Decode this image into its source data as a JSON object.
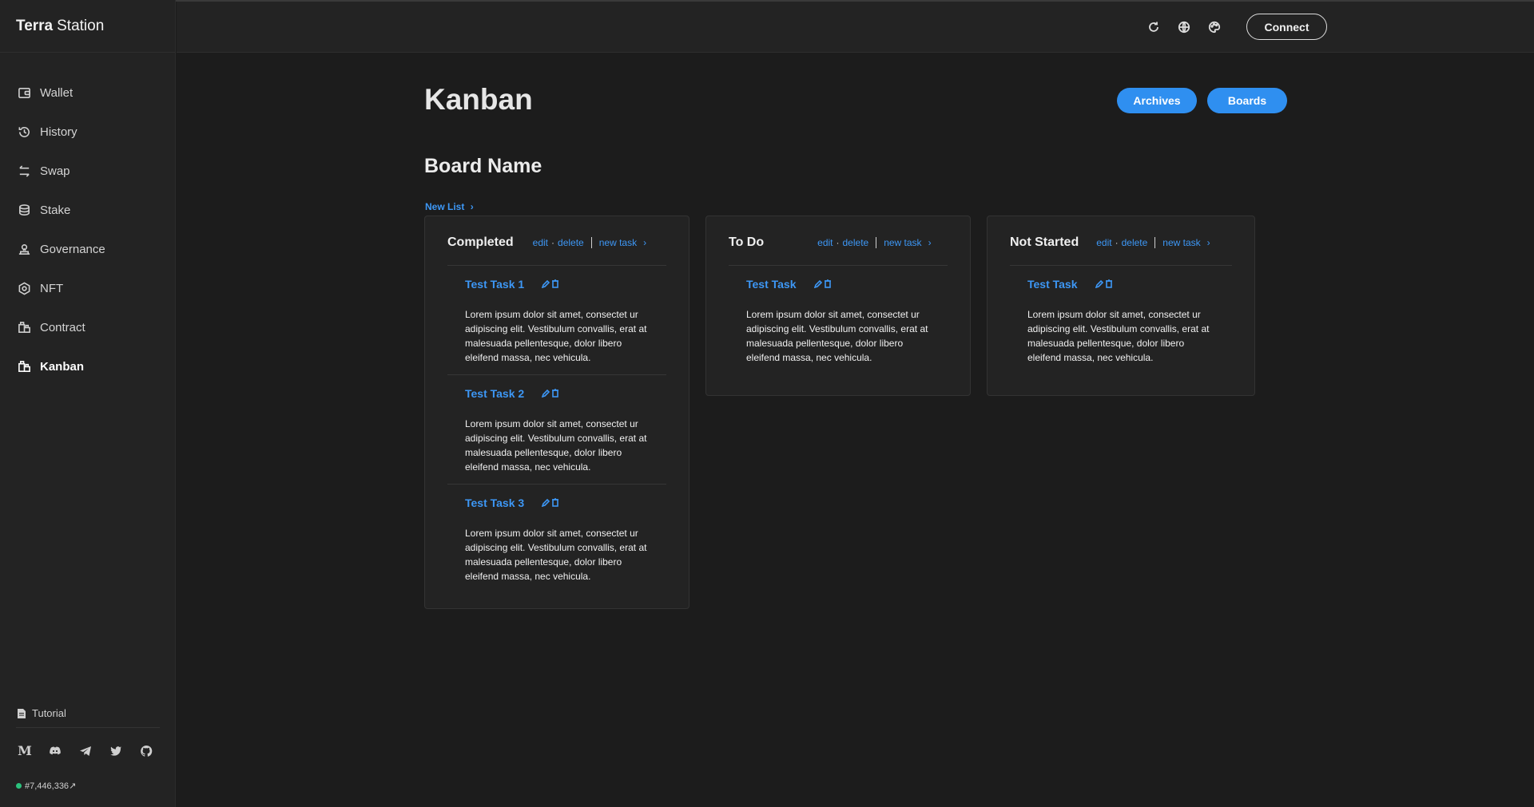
{
  "brand": {
    "bold": "Terra",
    "regular": "Station"
  },
  "nav": [
    {
      "label": "Wallet",
      "icon": "wallet-icon"
    },
    {
      "label": "History",
      "icon": "history-icon"
    },
    {
      "label": "Swap",
      "icon": "swap-icon"
    },
    {
      "label": "Stake",
      "icon": "stake-icon"
    },
    {
      "label": "Governance",
      "icon": "governance-icon"
    },
    {
      "label": "NFT",
      "icon": "nft-icon"
    },
    {
      "label": "Contract",
      "icon": "contract-icon"
    },
    {
      "label": "Kanban",
      "icon": "kanban-icon",
      "active": true
    }
  ],
  "sidebar_footer": {
    "tutorial": "Tutorial",
    "socials": [
      "medium-icon",
      "discord-icon",
      "telegram-icon",
      "twitter-icon",
      "github-icon"
    ],
    "block_height": "#7,446,336",
    "block_arrow": "↗",
    "status_color": "#2bc27d"
  },
  "header": {
    "connect": "Connect",
    "icons": [
      "refresh-icon",
      "globe-icon",
      "palette-icon"
    ]
  },
  "page": {
    "title": "Kanban",
    "archives": "Archives",
    "boards": "Boards",
    "board_name": "Board Name",
    "new_list": "New List",
    "new_list_chevron": "›"
  },
  "list_actions": {
    "edit": "edit",
    "dot": "·",
    "delete": "delete",
    "new_task": "new task",
    "chevron": "›"
  },
  "lists": [
    {
      "title": "Completed",
      "tasks": [
        {
          "title": "Test Task 1",
          "description": "Lorem ipsum dolor sit amet, consectet ur adipiscing elit. Vestibulum convallis, erat at malesuada pellentesque, dolor libero eleifend massa, nec vehicula."
        },
        {
          "title": "Test Task 2",
          "description": "Lorem ipsum dolor sit amet, consectet ur adipiscing elit. Vestibulum convallis, erat at malesuada pellentesque, dolor libero eleifend massa, nec vehicula."
        },
        {
          "title": "Test Task 3",
          "description": "Lorem ipsum dolor sit amet, consectet ur adipiscing elit. Vestibulum convallis, erat at malesuada pellentesque, dolor libero eleifend massa, nec vehicula."
        }
      ]
    },
    {
      "title": "To Do",
      "tasks": [
        {
          "title": "Test Task",
          "description": "Lorem ipsum dolor sit amet, consectet ur adipiscing elit. Vestibulum convallis, erat at malesuada pellentesque, dolor libero eleifend massa, nec vehicula."
        }
      ]
    },
    {
      "title": "Not Started",
      "tasks": [
        {
          "title": "Test Task",
          "description": "Lorem ipsum dolor sit amet, consectet ur adipiscing elit. Vestibulum convallis, erat at malesuada pellentesque, dolor libero eleifend massa, nec vehicula."
        }
      ]
    }
  ],
  "colors": {
    "accent": "#3d97f5",
    "button": "#2f8ff0",
    "background": "#1c1c1c",
    "panel": "#232323"
  }
}
